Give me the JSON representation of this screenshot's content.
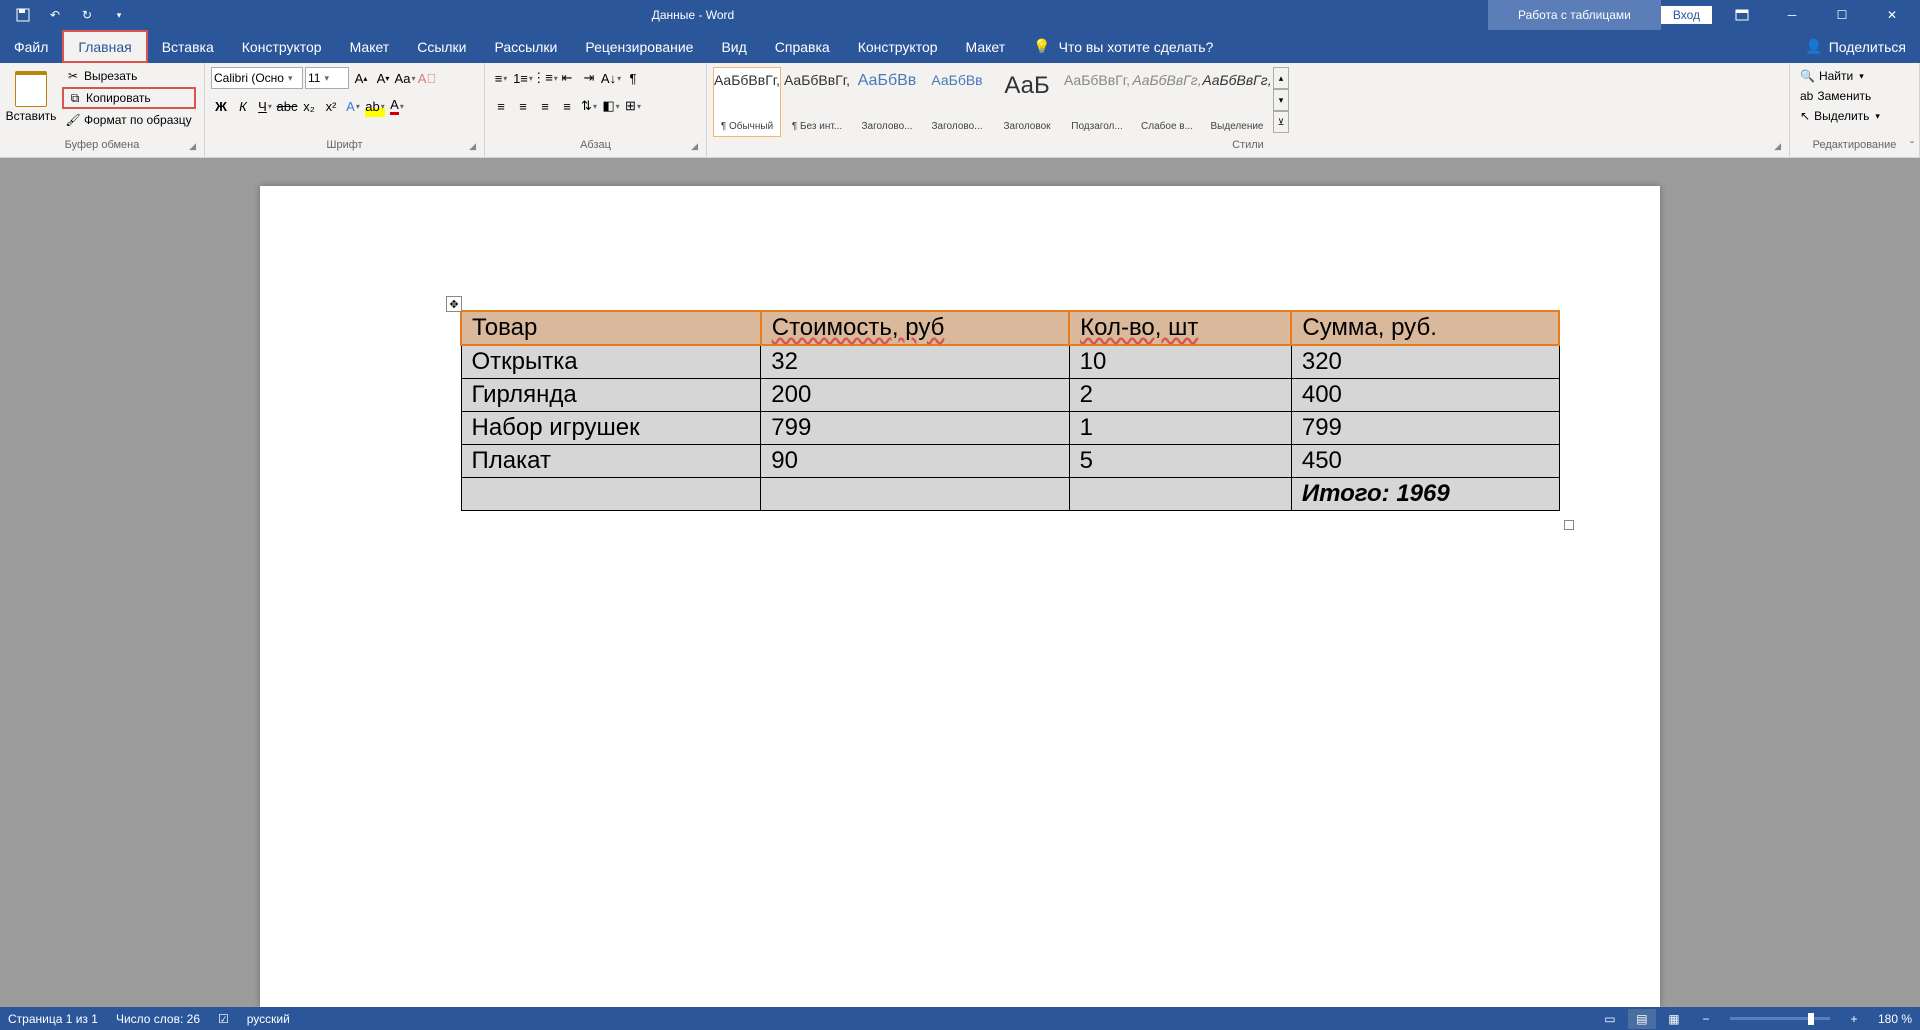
{
  "title": "Данные  -  Word",
  "context_tab": "Работа с таблицами",
  "signin": "Вход",
  "tabs": [
    "Файл",
    "Главная",
    "Вставка",
    "Конструктор",
    "Макет",
    "Ссылки",
    "Рассылки",
    "Рецензирование",
    "Вид",
    "Справка",
    "Конструктор",
    "Макет"
  ],
  "tellme": "Что вы хотите сделать?",
  "share": "Поделиться",
  "clipboard": {
    "paste": "Вставить",
    "cut": "Вырезать",
    "copy": "Копировать",
    "format_painter": "Формат по образцу",
    "label": "Буфер обмена"
  },
  "font": {
    "name": "Calibri (Осно",
    "size": "11",
    "label": "Шрифт"
  },
  "paragraph": {
    "label": "Абзац"
  },
  "styles": {
    "label": "Стили",
    "items": [
      {
        "preview": "АаБбВвГг,",
        "name": "¶ Обычный"
      },
      {
        "preview": "АаБбВвГг,",
        "name": "¶ Без инт..."
      },
      {
        "preview": "АаБбВв",
        "name": "Заголово..."
      },
      {
        "preview": "АаБбВв",
        "name": "Заголово..."
      },
      {
        "preview": "АаБ",
        "name": "Заголовок"
      },
      {
        "preview": "АаБбВвГг,",
        "name": "Подзагол..."
      },
      {
        "preview": "АаБбВвГг,",
        "name": "Слабое в..."
      },
      {
        "preview": "АаБбВвГг,",
        "name": "Выделение"
      }
    ]
  },
  "editing": {
    "find": "Найти",
    "replace": "Заменить",
    "select": "Выделить",
    "label": "Редактирование"
  },
  "table": {
    "headers": [
      "Товар",
      "Стоимость, руб",
      "Кол-во, шт",
      "Сумма, руб."
    ],
    "rows": [
      [
        "Открытка",
        "32",
        "10",
        "320"
      ],
      [
        "Гирлянда",
        "200",
        "2",
        "400"
      ],
      [
        "Набор игрушек",
        "799",
        "1",
        "799"
      ],
      [
        "Плакат",
        "90",
        "5",
        "450"
      ]
    ],
    "total": "Итого: 1969"
  },
  "status": {
    "page": "Страница 1 из 1",
    "words": "Число слов: 26",
    "lang": "русский",
    "zoom": "180 %"
  }
}
